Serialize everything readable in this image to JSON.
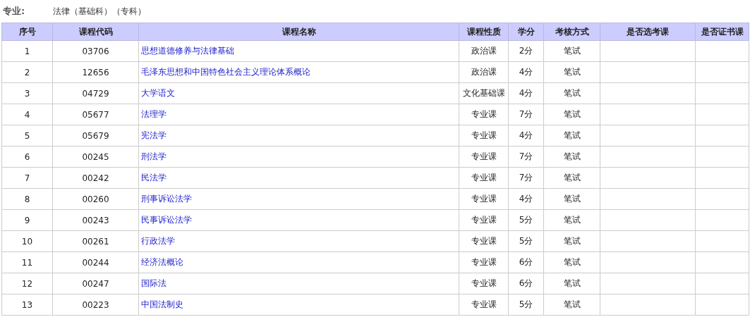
{
  "major": {
    "label": "专业:",
    "value": "法律（基础科）（专科）"
  },
  "table": {
    "columns": [
      "序号",
      "课程代码",
      "课程名称",
      "课程性质",
      "学分",
      "考核方式",
      "是否选考课",
      "是否证书课"
    ],
    "rows": [
      {
        "no": "1",
        "code": "03706",
        "name": "思想道德修养与法律基础",
        "type": "政治课",
        "credits": "2分",
        "exam": "笔试"
      },
      {
        "no": "2",
        "code": "12656",
        "name": "毛泽东思想和中国特色社会主义理论体系概论",
        "type": "政治课",
        "credits": "4分",
        "exam": "笔试"
      },
      {
        "no": "3",
        "code": "04729",
        "name": "大学语文",
        "type": "文化基础课",
        "credits": "4分",
        "exam": "笔试"
      },
      {
        "no": "4",
        "code": "05677",
        "name": "法理学",
        "type": "专业课",
        "credits": "7分",
        "exam": "笔试"
      },
      {
        "no": "5",
        "code": "05679",
        "name": "宪法学",
        "type": "专业课",
        "credits": "4分",
        "exam": "笔试"
      },
      {
        "no": "6",
        "code": "00245",
        "name": "刑法学",
        "type": "专业课",
        "credits": "7分",
        "exam": "笔试"
      },
      {
        "no": "7",
        "code": "00242",
        "name": "民法学",
        "type": "专业课",
        "credits": "7分",
        "exam": "笔试"
      },
      {
        "no": "8",
        "code": "00260",
        "name": "刑事诉讼法学",
        "type": "专业课",
        "credits": "4分",
        "exam": "笔试"
      },
      {
        "no": "9",
        "code": "00243",
        "name": "民事诉讼法学",
        "type": "专业课",
        "credits": "5分",
        "exam": "笔试"
      },
      {
        "no": "10",
        "code": "00261",
        "name": "行政法学",
        "type": "专业课",
        "credits": "5分",
        "exam": "笔试"
      },
      {
        "no": "11",
        "code": "00244",
        "name": "经济法概论",
        "type": "专业课",
        "credits": "6分",
        "exam": "笔试"
      },
      {
        "no": "12",
        "code": "00247",
        "name": "国际法",
        "type": "专业课",
        "credits": "6分",
        "exam": "笔试"
      },
      {
        "no": "13",
        "code": "00223",
        "name": "中国法制史",
        "type": "专业课",
        "credits": "5分",
        "exam": "笔试"
      }
    ]
  }
}
